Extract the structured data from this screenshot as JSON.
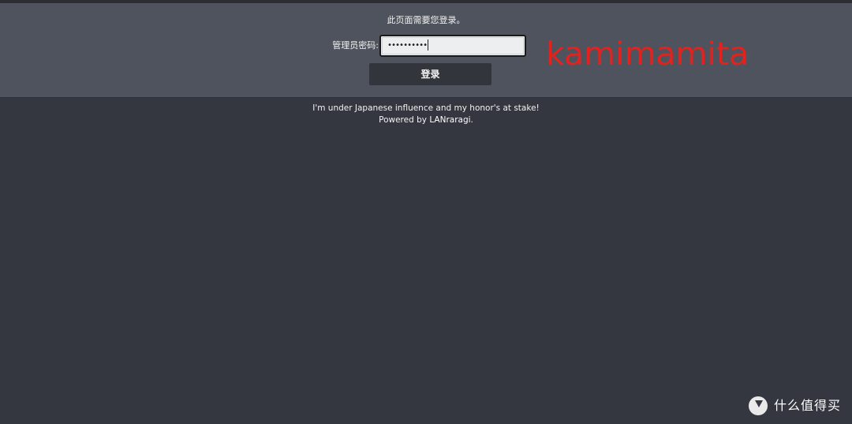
{
  "login": {
    "message": "此页面需要您登录。",
    "password_label": "管理员密码:",
    "password_value": "••••••••••",
    "button_label": "登录"
  },
  "overlay": {
    "username_watermark": "kamimamita"
  },
  "footer": {
    "tagline": "I'm under Japanese influence and my honor's at stake!",
    "powered_prefix": "Powered by ",
    "powered_link": "LANraragi",
    "powered_suffix": "."
  },
  "watermark": {
    "icon": "smzdm-logo-icon",
    "text": "什么值得买"
  },
  "colors": {
    "background": "#353740",
    "panel": "#4f535d",
    "button": "#33353d",
    "watermark_red": "#e0231f"
  }
}
